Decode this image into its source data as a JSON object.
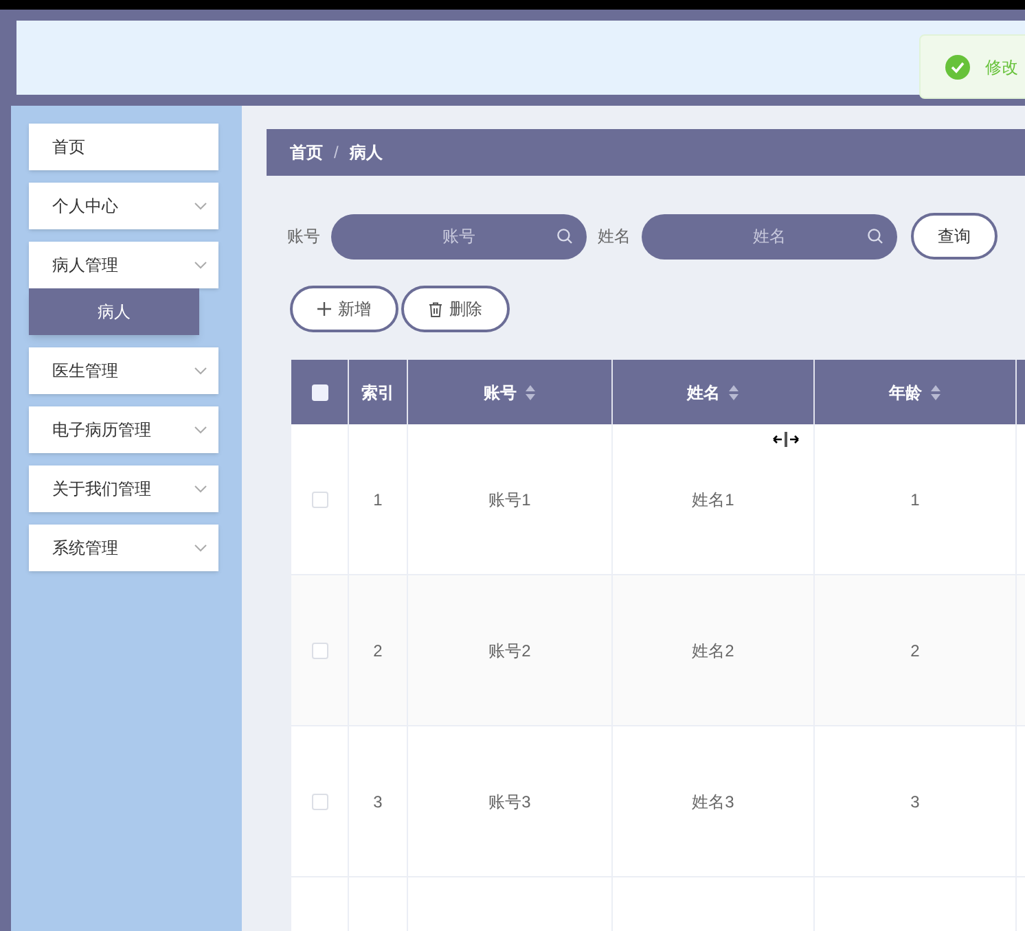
{
  "toast": {
    "text": "修改"
  },
  "sidebar": {
    "items": [
      {
        "label": "首页",
        "selected": false,
        "expandable": false
      },
      {
        "label": "个人中心",
        "selected": false,
        "expandable": true
      },
      {
        "label": "病人管理",
        "selected": false,
        "expandable": true,
        "children": [
          {
            "label": "病人",
            "selected": true
          }
        ]
      },
      {
        "label": "医生管理",
        "selected": false,
        "expandable": true
      },
      {
        "label": "电子病历管理",
        "selected": false,
        "expandable": true
      },
      {
        "label": "关于我们管理",
        "selected": false,
        "expandable": true
      },
      {
        "label": "系统管理",
        "selected": false,
        "expandable": true
      }
    ]
  },
  "breadcrumb": [
    "首页",
    "病人"
  ],
  "breadcrumb_separator": "/",
  "search": {
    "fields": [
      {
        "label": "账号",
        "placeholder": "账号"
      },
      {
        "label": "姓名",
        "placeholder": "姓名"
      }
    ],
    "button": "查询"
  },
  "actions": [
    {
      "kind": "add",
      "label": "新增"
    },
    {
      "kind": "delete",
      "label": "删除"
    }
  ],
  "table": {
    "header_checked": false,
    "columns": [
      {
        "label": "索引",
        "sortable": false
      },
      {
        "label": "账号",
        "sortable": true
      },
      {
        "label": "姓名",
        "sortable": true
      },
      {
        "label": "年龄",
        "sortable": true
      }
    ],
    "rows": [
      {
        "checked": false,
        "cells": [
          "1",
          "账号1",
          "姓名1",
          "1"
        ]
      },
      {
        "checked": false,
        "cells": [
          "2",
          "账号2",
          "姓名2",
          "2"
        ]
      },
      {
        "checked": false,
        "cells": [
          "3",
          "账号3",
          "姓名3",
          "3"
        ]
      }
    ]
  }
}
